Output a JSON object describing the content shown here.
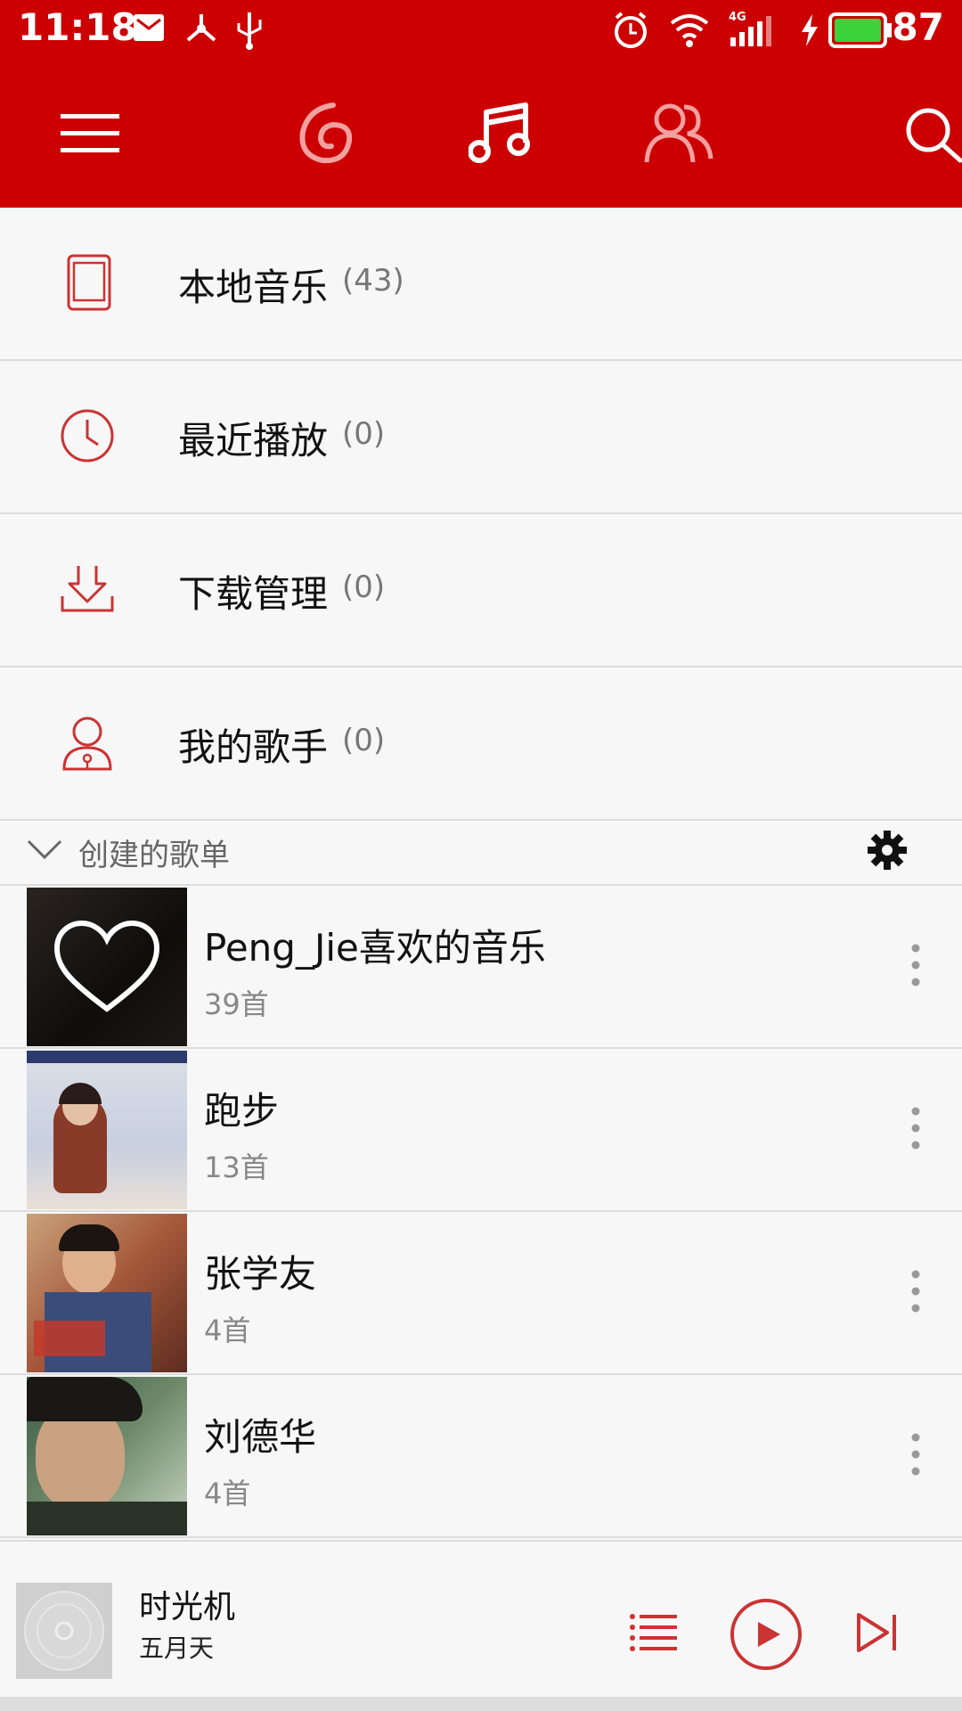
{
  "status_bar": {
    "time": "11:18",
    "battery": "87",
    "network": "4G",
    "icons": [
      "mail-icon",
      "share-icon",
      "usb-icon",
      "alarm-icon",
      "wifi-icon",
      "signal-icon",
      "charging-icon",
      "battery-icon"
    ]
  },
  "top_nav": {
    "icons": [
      "menu-icon",
      "discover-icon",
      "music-icon",
      "friends-icon",
      "search-icon"
    ]
  },
  "menu": {
    "items": [
      {
        "label": "本地音乐",
        "count": "(43)",
        "icon": "phone-icon"
      },
      {
        "label": "最近播放",
        "count": "(0)",
        "icon": "clock-icon"
      },
      {
        "label": "下载管理",
        "count": "(0)",
        "icon": "download-icon"
      },
      {
        "label": "我的歌手",
        "count": "(0)",
        "icon": "singer-icon"
      }
    ]
  },
  "section": {
    "label": "创建的歌单"
  },
  "playlists": [
    {
      "title": "Peng_Jie喜欢的音乐",
      "count": "39首"
    },
    {
      "title": "跑步",
      "count": "13首"
    },
    {
      "title": "张学友",
      "count": "4首"
    },
    {
      "title": "刘德华",
      "count": "4首"
    }
  ],
  "player": {
    "song": "时光机",
    "artist": "五月天"
  },
  "colors": {
    "brand": "#cc0000",
    "accent": "#cc3333"
  }
}
